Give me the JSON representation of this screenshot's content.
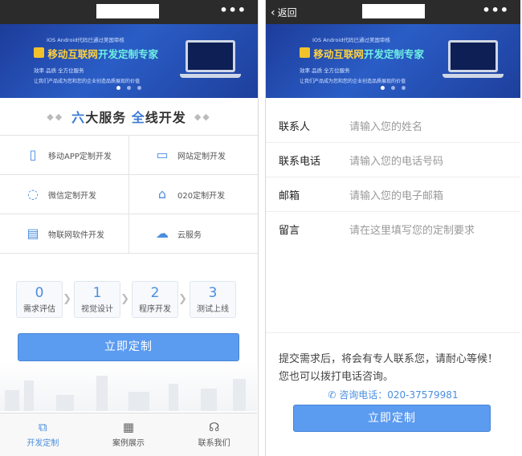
{
  "left": {
    "banner": {
      "top_line": "IOS Android代码已通过美国审核",
      "title_part1": "移动互联网",
      "title_part2": "开发定制专家",
      "sub1": "效率 品质 全方位服务",
      "sub2": "让我们产品成为您和您的企业创造品质展现的价值"
    },
    "services_heading": {
      "first_char1": "六",
      "rest1": "大服务",
      "first_char2": "全",
      "rest2": "线开发"
    },
    "services": [
      {
        "label": "移动APP定制开发",
        "icon": "mobile-icon"
      },
      {
        "label": "网站定制开发",
        "icon": "monitor-icon"
      },
      {
        "label": "微信定制开发",
        "icon": "wechat-icon"
      },
      {
        "label": "020定制开发",
        "icon": "store-icon"
      },
      {
        "label": "物联网软件开发",
        "icon": "iot-icon"
      },
      {
        "label": "云服务",
        "icon": "cloud-icon"
      }
    ],
    "steps": [
      {
        "num": "0",
        "label": "需求评估"
      },
      {
        "num": "1",
        "label": "视觉设计"
      },
      {
        "num": "2",
        "label": "程序开发"
      },
      {
        "num": "3",
        "label": "测试上线"
      }
    ],
    "cta": "立即定制",
    "tabs": [
      {
        "label": "开发定制",
        "icon": "layers-icon",
        "active": true
      },
      {
        "label": "案例展示",
        "icon": "grid-icon",
        "active": false
      },
      {
        "label": "联系我们",
        "icon": "headset-icon",
        "active": false
      }
    ]
  },
  "right": {
    "back_label": "返回",
    "banner": {
      "top_line": "IOS Android代码已通过美国审核",
      "title_part1": "移动互联网",
      "title_part2": "开发定制专家",
      "sub1": "效率 品质 全方位服务",
      "sub2": "让我们产品成为您和您的企业创造品质展现的价值"
    },
    "form": [
      {
        "label": "联系人",
        "placeholder": "请输入您的姓名"
      },
      {
        "label": "联系电话",
        "placeholder": "请输入您的电话号码"
      },
      {
        "label": "邮箱",
        "placeholder": "请输入您的电子邮箱"
      },
      {
        "label": "留言",
        "placeholder": "请在这里填写您的定制要求"
      }
    ],
    "note": "提交需求后，将会有专人联系您，请耐心等候！您也可以拨打电话咨询。",
    "phone": "咨询电话：020-37579981",
    "cta": "立即定制"
  },
  "colors": {
    "accent": "#4a8ee0",
    "button": "#5b9bf0",
    "topbar": "#2b2b2b",
    "banner": "#2a5dc6"
  }
}
